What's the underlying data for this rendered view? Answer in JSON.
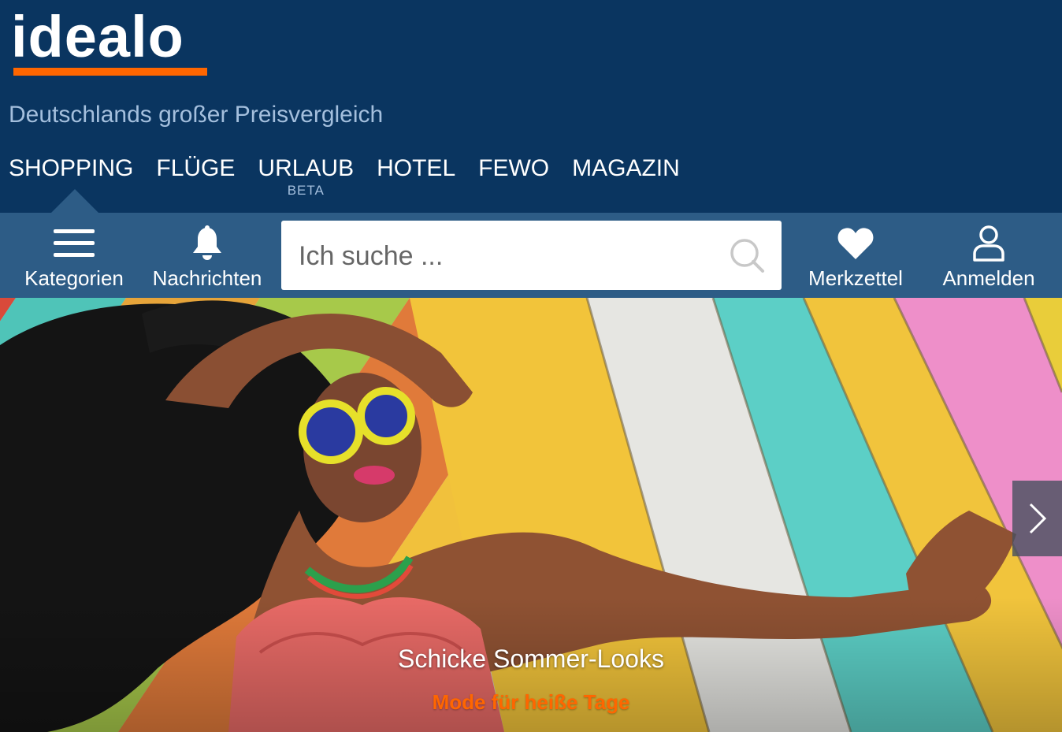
{
  "header": {
    "logo_text": "idealo",
    "tagline": "Deutschlands großer Preisvergleich",
    "nav": [
      {
        "label": "SHOPPING",
        "badge": ""
      },
      {
        "label": "FLÜGE",
        "badge": ""
      },
      {
        "label": "URLAUB",
        "badge": "BETA"
      },
      {
        "label": "HOTEL",
        "badge": ""
      },
      {
        "label": "FEWO",
        "badge": ""
      },
      {
        "label": "MAGAZIN",
        "badge": ""
      }
    ],
    "active_nav": "SHOPPING"
  },
  "toolbar": {
    "categories_label": "Kategorien",
    "notifications_label": "Nachrichten",
    "search_placeholder": "Ich suche ...",
    "wishlist_label": "Merkzettel",
    "login_label": "Anmelden"
  },
  "hero": {
    "title": "Schicke Sommer-Looks",
    "subtitle": "Mode für heiße Tage",
    "next_icon": "chevron-right-icon"
  },
  "colors": {
    "header_bg": "#0a3560",
    "toolbar_bg": "#2d5c86",
    "accent": "#ff6600",
    "tagline": "#a4bfdd"
  }
}
